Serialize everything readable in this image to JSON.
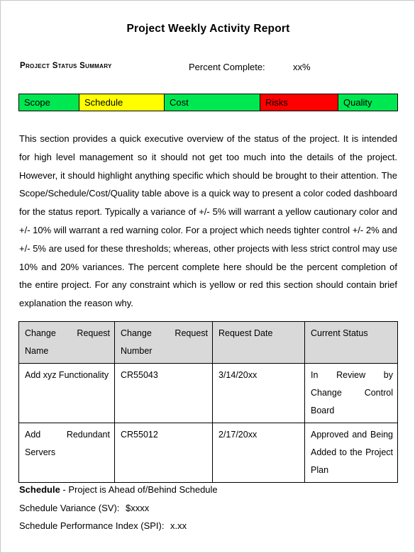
{
  "document": {
    "title": "Project Weekly Activity  Report",
    "section_heading": "Project Status Summary",
    "percent_complete_label": "Percent Complete:",
    "percent_complete_value": "xx%"
  },
  "status_dashboard": {
    "cells": [
      {
        "label": "Scope",
        "color": "#00E851",
        "status": "green"
      },
      {
        "label": "Schedule",
        "color": "#FFFF00",
        "status": "yellow"
      },
      {
        "label": "Cost",
        "color": "#00E851",
        "status": "green"
      },
      {
        "label": "Risks",
        "color": "#FF0000",
        "status": "red"
      },
      {
        "label": "Quality",
        "color": "#00E851",
        "status": "green"
      }
    ]
  },
  "summary_paragraph": "This section provides a quick executive overview of the status of the project.  It is intended for high level management so it should not get too much into the details of the project.  However, it should highlight anything specific which should be brought to their attention.   The Scope/Schedule/Cost/Quality table above is a quick way to present a color coded dashboard for the status report.  Typically a variance of +/- 5% will warrant a yellow cautionary color and +/- 10% will warrant a red warning color.  For a project which needs tighter control +/- 2% and +/- 5% are used for these thresholds; whereas, other projects with less strict control may use 10% and 20% variances.  The percent complete here should be the percent completion of the entire project.  For any constraint which is yellow or red this section should contain brief explanation the reason why.",
  "change_request_table": {
    "headers": [
      "Change Request Name",
      "Change Request Number",
      "Request Date",
      "Current Status"
    ],
    "rows": [
      {
        "name": "Add xyz Functionality",
        "number": "CR55043",
        "date": "3/14/20xx",
        "status": "In Review by Change Control Board"
      },
      {
        "name": "Add Redundant Servers",
        "number": "CR55012",
        "date": "2/17/20xx",
        "status": "Approved and Being Added to the Project Plan"
      }
    ]
  },
  "schedule_section": {
    "heading": "Schedule",
    "heading_suffix": " - Project is Ahead of/Behind Schedule",
    "variance_label": "Schedule Variance (SV):",
    "variance_value": "$xxxx",
    "spi_label": "Schedule Performance Index (SPI):",
    "spi_value": "x.xx"
  }
}
